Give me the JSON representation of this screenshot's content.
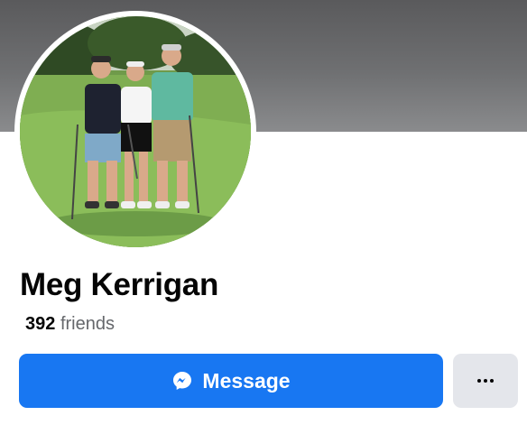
{
  "profile": {
    "name": "Meg Kerrigan",
    "friends_count": "392",
    "friends_label": "friends"
  },
  "actions": {
    "message_label": "Message",
    "message_icon": "messenger-icon",
    "more_icon": "more-dots-icon"
  },
  "colors": {
    "primary_button": "#1877f2",
    "secondary_button": "#e4e6eb",
    "cover": "#6f7072"
  }
}
